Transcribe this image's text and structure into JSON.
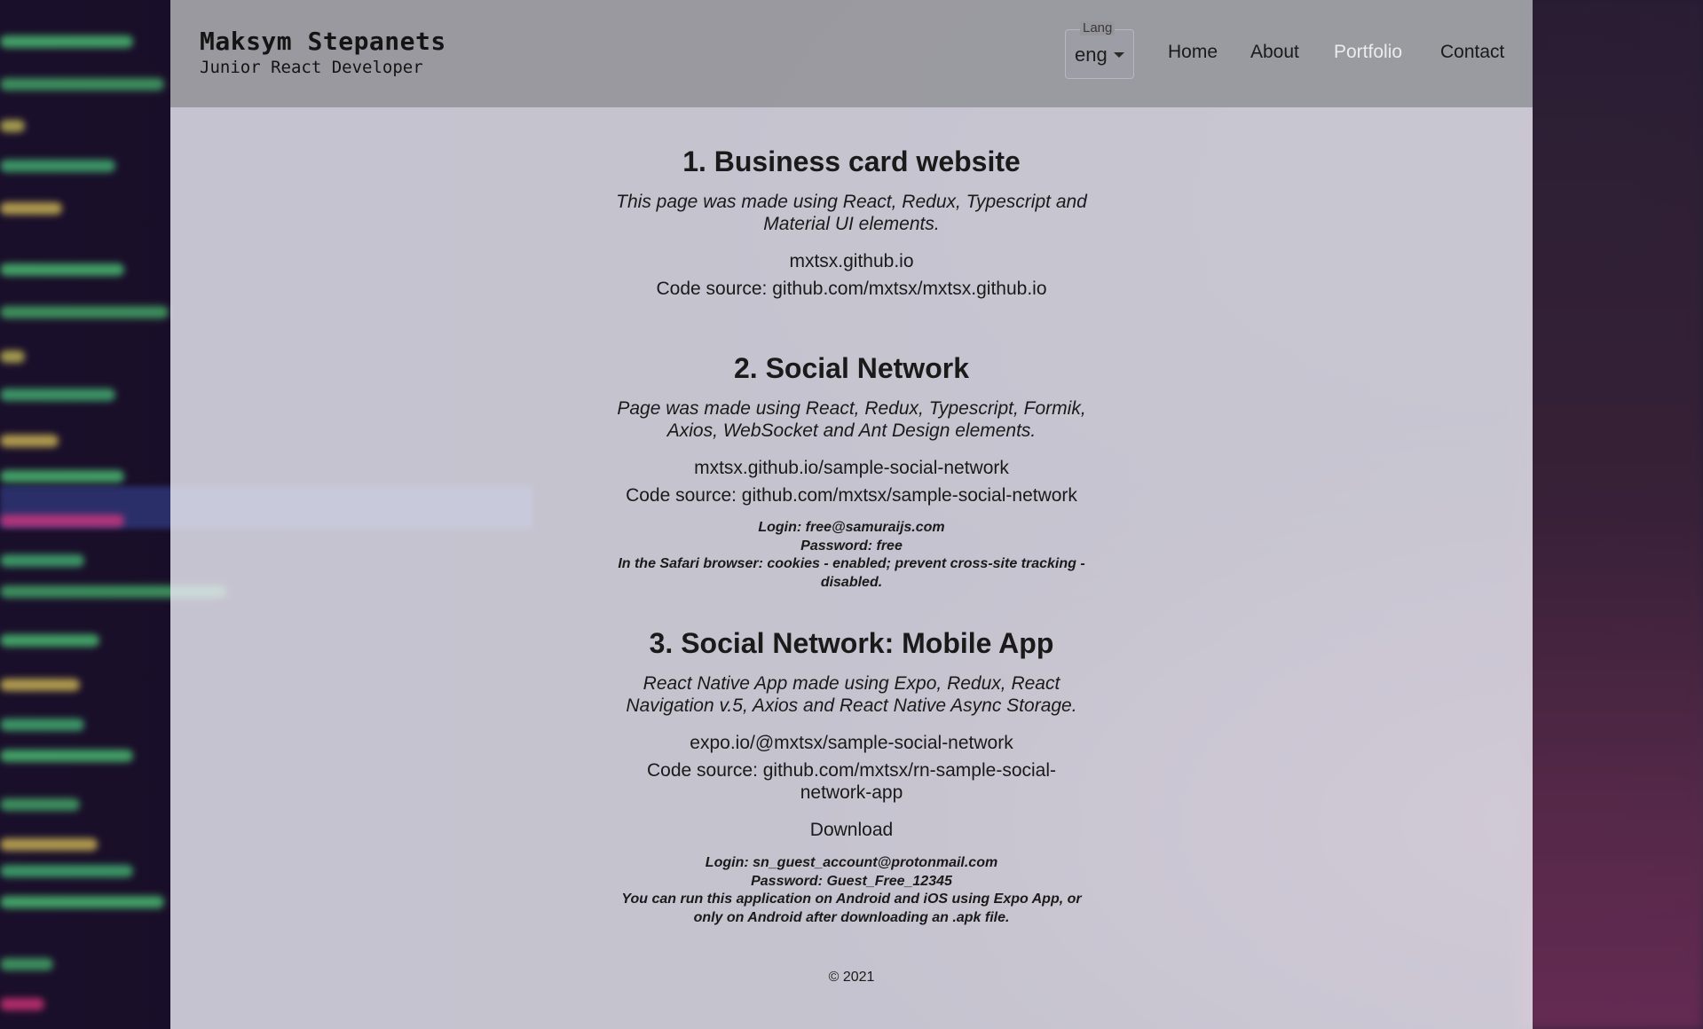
{
  "header": {
    "name": "Maksym Stepanets",
    "role": "Junior React Developer",
    "lang_label": "Lang",
    "lang_value": "eng",
    "nav": [
      "Home",
      "About",
      "Portfolio",
      "Contact"
    ],
    "active_nav": "Portfolio"
  },
  "projects": [
    {
      "title": "1. Business card website",
      "description": "This page was made using React, Redux, Typescript and Material UI elements.",
      "site_link": "mxtsx.github.io",
      "source_link": "Code source: github.com/mxtsx/mxtsx.github.io"
    },
    {
      "title": "2. Social Network",
      "description": "Page was made using React, Redux, Typescript, Formik, Axios, WebSocket and Ant Design elements.",
      "site_link": "mxtsx.github.io/sample-social-network",
      "source_link": "Code source: github.com/mxtsx/sample-social-network",
      "notes": [
        "Login: free@samuraijs.com",
        "Password: free",
        "In the Safari browser: cookies - enabled; prevent cross-site tracking - disabled."
      ]
    },
    {
      "title": "3. Social Network: Mobile App",
      "description": "React Native App made using Expo, Redux, React Navigation v.5, Axios and React Native Async Storage.",
      "site_link": "expo.io/@mxtsx/sample-social-network",
      "source_link": "Code source: github.com/mxtsx/rn-sample-social-network-app",
      "download": "Download",
      "notes": [
        "Login: sn_guest_account@protonmail.com",
        "Password: Guest_Free_12345",
        "You can run this application on Android and iOS using Expo App, or only on Android after downloading an .apk file."
      ]
    }
  ],
  "footer": "© 2021",
  "colors": {
    "header_bg": "#96969c",
    "content_bg": "#ececf4",
    "active_nav": "#ececec",
    "text": "#1a1a1a"
  }
}
